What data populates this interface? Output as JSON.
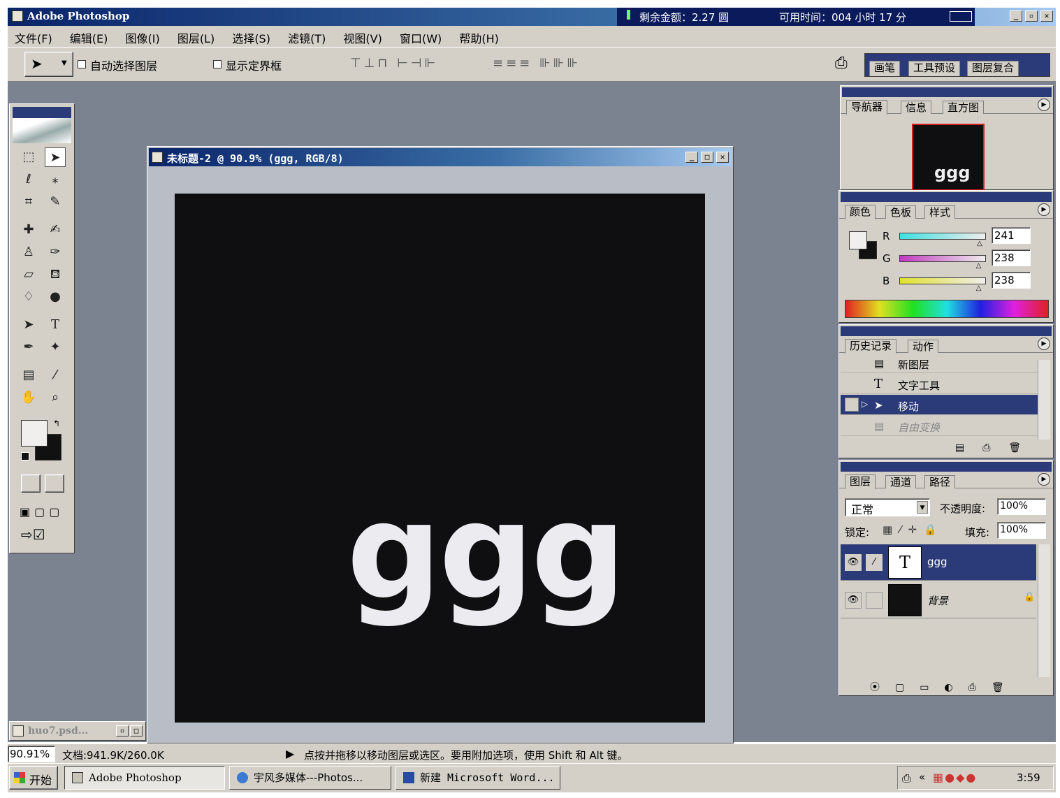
{
  "app": {
    "title": "Adobe Photoshop",
    "balance": "剩余金额：2.27 圆",
    "time_available": "可用时间：004 小时 17 分"
  },
  "menu": [
    "文件(F)",
    "编辑(E)",
    "图像(I)",
    "图层(L)",
    "选择(S)",
    "滤镜(T)",
    "视图(V)",
    "窗口(W)",
    "帮助(H)"
  ],
  "options": {
    "auto_select": "自动选择图层",
    "show_bounds": "显示定界框"
  },
  "palette_well_tabs": [
    "画笔",
    "工具预设",
    "图层复合"
  ],
  "document": {
    "title": "未标题-2 @ 90.9% (ggg, RGB/8)",
    "text": "ggg",
    "canvas_color": "#0f0e10",
    "text_color": "#ecebef"
  },
  "minimized_doc": "huo7.psd...",
  "navigator": {
    "tabs": [
      "导航器",
      "信息",
      "直方图"
    ],
    "preview_text": "ggg"
  },
  "color_panel": {
    "tabs": [
      "颜色",
      "色板",
      "样式"
    ],
    "r_label": "R",
    "g_label": "G",
    "b_label": "B",
    "r": "241",
    "g": "238",
    "b": "238",
    "r_fraction": 0.945,
    "g_fraction": 0.933,
    "b_fraction": 0.933
  },
  "history": {
    "tabs": [
      "历史记录",
      "动作"
    ],
    "items": [
      "新图层",
      "文字工具",
      "移动",
      "自由变换"
    ]
  },
  "layers": {
    "tabs": [
      "图层",
      "通道",
      "路径"
    ],
    "blend_mode": "正常",
    "opacity_label": "不透明度:",
    "opacity": "100%",
    "lock_label": "锁定:",
    "fill_label": "填充:",
    "fill": "100%",
    "items": [
      {
        "name": "ggg",
        "thumb": "T"
      },
      {
        "name": "背景",
        "thumb": ""
      }
    ]
  },
  "status": {
    "zoom": "90.91%",
    "doc_size": "文档:941.9K/260.0K",
    "hint": "点按并拖移以移动图层或选区。要用附加选项，使用 Shift 和 Alt 键。"
  },
  "taskbar": {
    "start": "开始",
    "buttons": [
      "Adobe Photoshop",
      "宇风多媒体---Photos...",
      "新建 Microsoft Word..."
    ],
    "clock": "3:59"
  },
  "colors": {
    "desktop": "#7b8290",
    "accent": "#2b3a78",
    "chrome": "#d4d0c8"
  }
}
